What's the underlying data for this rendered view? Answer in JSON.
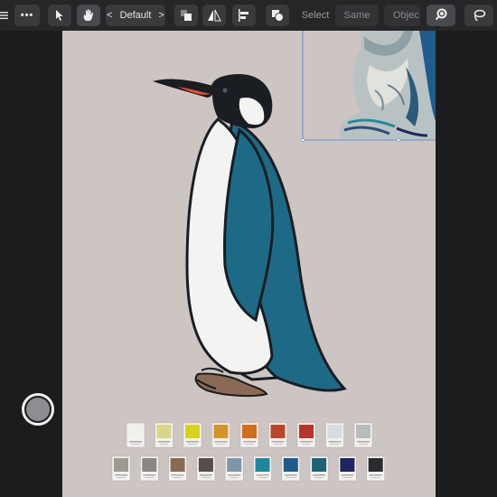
{
  "toolbar": {
    "menu_icon": "hamburger-icon",
    "more_icon": "more-icon",
    "move_tool_icon": "cursor-arrow-icon",
    "hand_tool_icon": "hand-icon",
    "style_prev": "<",
    "style_label": "Default",
    "style_next": ">",
    "arrange_icon": "arrange-icon",
    "flip_icon": "flip-icon",
    "align_icon": "align-icon",
    "boolean_icon": "boolean-icon",
    "select_label": "Select",
    "same_label": "Same",
    "object_label": "Objec",
    "zoom_icon": "zoom-icon",
    "lasso_icon": "lasso-icon"
  },
  "colors": {
    "background": "#cdc5c2",
    "penguin_blue": "#1d6a87",
    "penguin_black": "#1a1d22",
    "beak_orange": "#e0532c",
    "feet_brown": "#8a6a55"
  },
  "palette_row1": [
    "#f1efea",
    "#d9d68a",
    "#d9d21c",
    "#d0962b",
    "#d26d1e",
    "#b8472a",
    "#b7342e",
    "#d5dde3",
    "#b9bbbd"
  ],
  "palette_row2": [
    "#9d9a91",
    "#8b8884",
    "#8a6a55",
    "#5a4e4a",
    "#7e96a9",
    "#1e879e",
    "#1f5b8b",
    "#1d6373",
    "#1e2660",
    "#2a2b2f"
  ],
  "record_button_icon": "record-icon"
}
